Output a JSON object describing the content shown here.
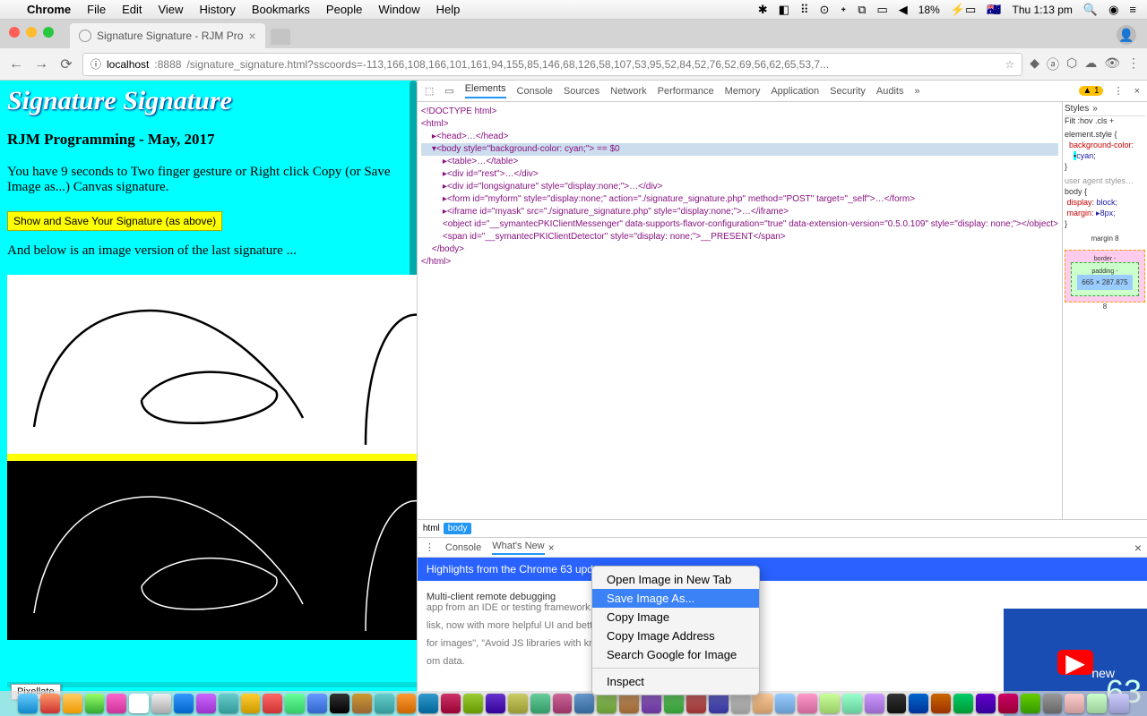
{
  "menubar": {
    "app": "Chrome",
    "items": [
      "File",
      "Edit",
      "View",
      "History",
      "Bookmarks",
      "People",
      "Window",
      "Help"
    ],
    "battery": "18%",
    "clock": "Thu 1:13 pm"
  },
  "tab": {
    "title": "Signature Signature - RJM Pro"
  },
  "addr": {
    "host": "localhost",
    "port": ":8888",
    "path": "/signature_signature.html?sscoords=-113,166,108,166,101,161,94,155,85,146,68,126,58,107,53,95,52,84,52,76,52,69,56,62,65,53,7..."
  },
  "page": {
    "title": "Signature Signature",
    "subtitle": "RJM Programming - May, 2017",
    "instruction": "You have 9 seconds to Two finger gesture or Right click Copy (or Save Image as...) Canvas signature.",
    "button": "Show and Save Your Signature (as above)",
    "below_text": "And below is an image version of the last signature ...",
    "pixellate": "Pixellate"
  },
  "devtools": {
    "tabs": [
      "Elements",
      "Console",
      "Sources",
      "Network",
      "Performance",
      "Memory",
      "Application",
      "Security",
      "Audits"
    ],
    "warn": "▲ 1",
    "dom": {
      "l1": "<!DOCTYPE html>",
      "l2": "<html>",
      "l3": "▸<head>…</head>",
      "l4": "▾<body style=\"background-color: cyan;\"> == $0",
      "l5": "▸<table>…</table>",
      "l6": "▸<div id=\"rest\">…</div>",
      "l7": "▸<div id=\"longsignature\" style=\"display:none;\">…</div>",
      "l8": "▸<form id=\"myform\" style=\"display:none;\" action=\"./signature_signature.php\" method=\"POST\" target=\"_self\">…</form>",
      "l9": "▸<iframe id=\"myask\" src=\"./signature_signature.php\" style=\"display:none;\">…</iframe>",
      "l10": "<object id=\"__symantecPKIClientMessenger\" data-supports-flavor-configuration=\"true\" data-extension-version=\"0.5.0.109\" style=\"display: none;\"></object>",
      "l11": "<span id=\"__symantecPKIClientDetector\" style=\"display: none;\">__PRESENT</span>",
      "l12": "</body>",
      "l13": "</html>"
    },
    "breadcrumb": {
      "a": "html",
      "b": "body"
    },
    "styles": {
      "tab": "Styles",
      "filter": "Filt  :hov  .cls  +",
      "r1": "element.style {",
      "r1p": "background-color:",
      "r1v": "cyan;",
      "r2": "user agent styles…",
      "r3": "body {",
      "r3p1": "display:",
      "r3v1": "block;",
      "r3p2": "margin:",
      "r3v2": "▸8px;",
      "box": "665 × 287.875",
      "margin": "margin   8",
      "border": "border  -",
      "padding": "padding -"
    },
    "drawer": {
      "tabs": {
        "console": "Console",
        "whatsnew": "What's New"
      },
      "header": "Highlights from the Chrome 63 update",
      "items": [
        {
          "t": "Multi-client remote debugging",
          "d": "app from an IDE or testing framework."
        },
        {
          "t": "",
          "d": "lisk, now with more helpful UI and better auto-"
        },
        {
          "t": "",
          "d": "for images\", \"Avoid JS libraries with known"
        },
        {
          "t": "",
          "d": "om data."
        }
      ],
      "video_label": "new",
      "video_num": "63"
    }
  },
  "context_menu": {
    "items": [
      "Open Image in New Tab",
      "Save Image As...",
      "Copy Image",
      "Copy Image Address",
      "Search Google for Image"
    ],
    "inspect": "Inspect",
    "highlighted": 1
  }
}
